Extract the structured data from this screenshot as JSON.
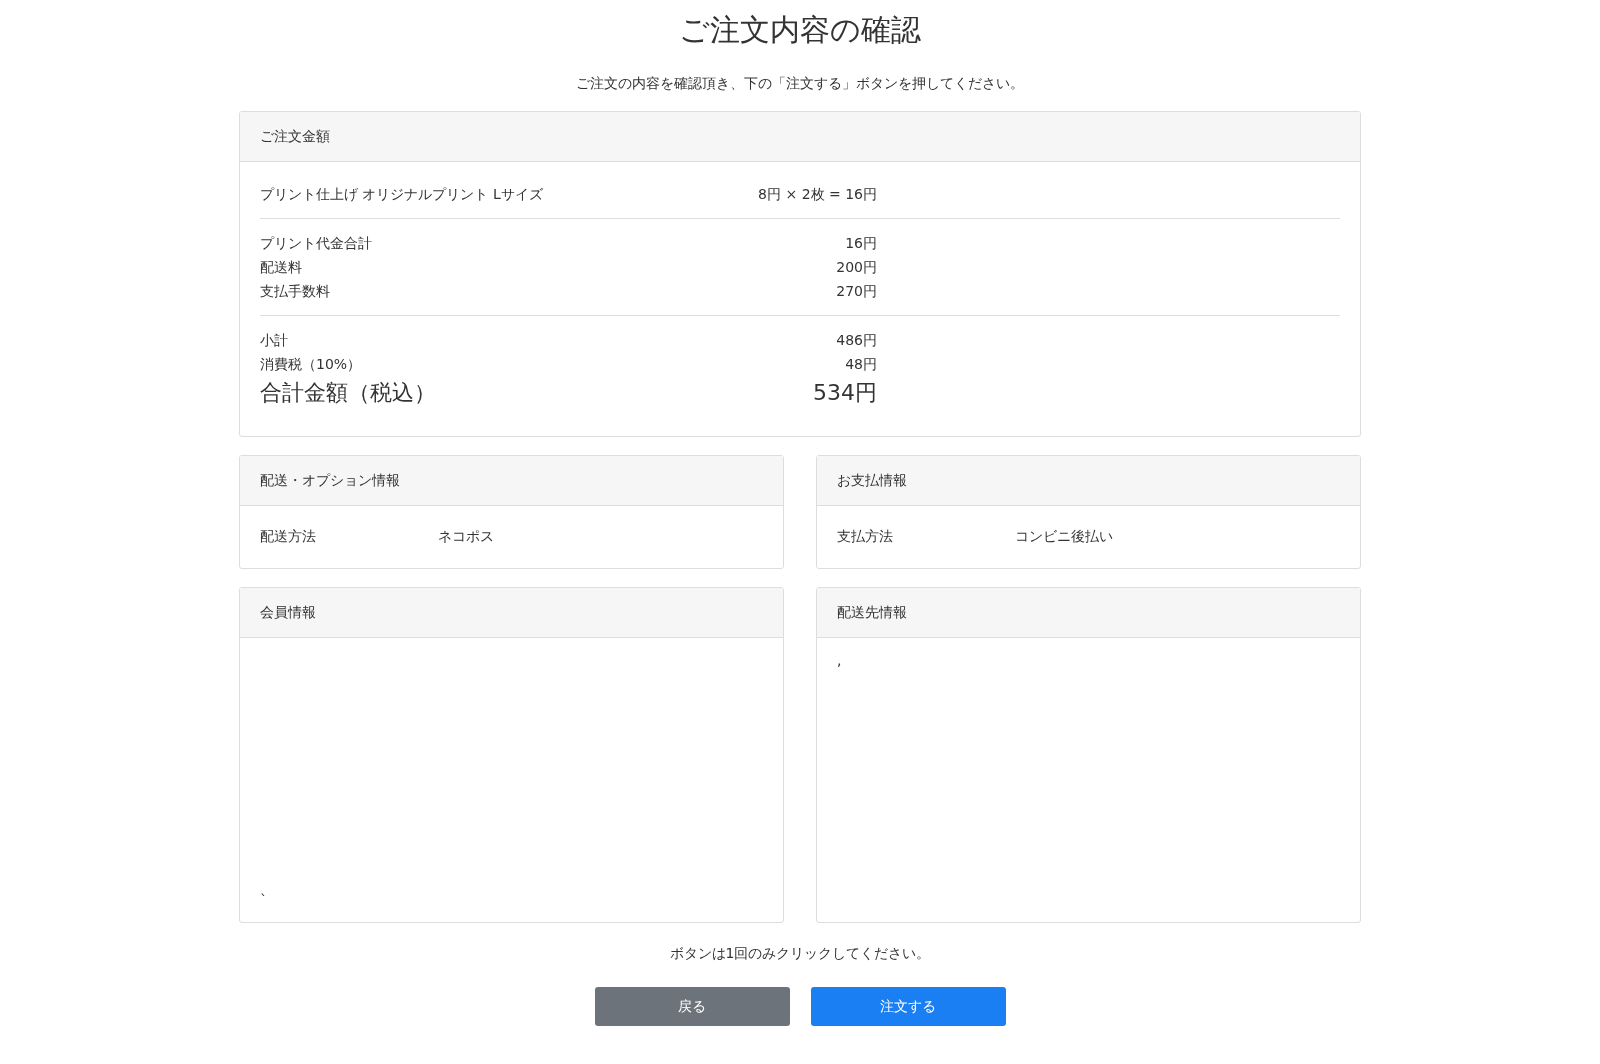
{
  "title": "ご注文内容の確認",
  "subtitle": "ご注文の内容を確認頂き、下の「注文する」ボタンを押してください。",
  "order_amount": {
    "header": "ご注文金額",
    "groups": [
      {
        "rows": [
          {
            "label": "プリント仕上げ オリジナルプリント Lサイズ",
            "value": "8円 × 2枚 = 16円"
          }
        ]
      },
      {
        "rows": [
          {
            "label": "プリント代金合計",
            "value": "16円"
          },
          {
            "label": "配送料",
            "value": "200円"
          },
          {
            "label": "支払手数料",
            "value": "270円"
          }
        ]
      },
      {
        "rows": [
          {
            "label": "小計",
            "value": "486円"
          },
          {
            "label": "消費税（10%）",
            "value": "48円"
          },
          {
            "label": "合計金額（税込）",
            "value": "534円",
            "kind": "total"
          }
        ]
      }
    ]
  },
  "shipping_options": {
    "header": "配送・オプション情報",
    "rows": [
      {
        "label": "配送方法",
        "value": "ネコポス"
      }
    ]
  },
  "payment": {
    "header": "お支払情報",
    "rows": [
      {
        "label": "支払方法",
        "value": "コンビニ後払い"
      }
    ]
  },
  "member": {
    "header": "会員情報",
    "text": "`"
  },
  "destination": {
    "header": "配送先情報",
    "text": ","
  },
  "note": "ボタンは1回のみクリックしてください。",
  "buttons": [
    {
      "label": "戻る",
      "kind": "secondary"
    },
    {
      "label": "注文する",
      "kind": "primary"
    }
  ]
}
